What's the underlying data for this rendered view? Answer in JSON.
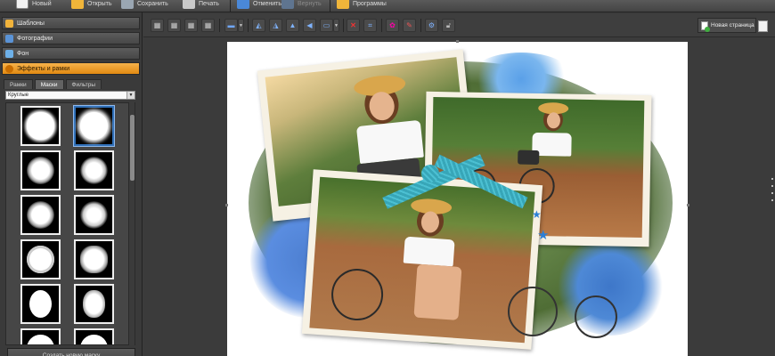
{
  "topbar": {
    "items": [
      {
        "label": "Новый"
      },
      {
        "label": "Открыть"
      },
      {
        "label": "Сохранить"
      },
      {
        "label": "Печать"
      },
      {
        "label": "Отменить"
      },
      {
        "label": "Вернуть"
      },
      {
        "label": "Программы"
      }
    ]
  },
  "sidebar": {
    "sections": [
      {
        "label": "Шаблоны"
      },
      {
        "label": "Фотографии"
      },
      {
        "label": "Фон"
      },
      {
        "label": "Эффекты и рамки"
      }
    ],
    "tabs": [
      {
        "label": "Рамки"
      },
      {
        "label": "Маски"
      },
      {
        "label": "Фильтры"
      }
    ],
    "select_value": "Круглые",
    "create_mask_label": "Создать новую маску"
  },
  "editor": {
    "new_page_label": "Новая страница"
  },
  "colors": {
    "accent_orange": "#e28a12",
    "selection_blue": "#2f6fb8",
    "ribbon_teal": "#37a6b8"
  }
}
